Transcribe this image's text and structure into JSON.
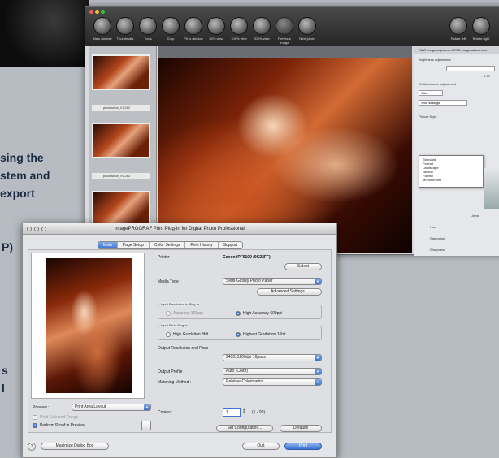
{
  "background_text": [
    "sing the",
    "stem and",
    " export",
    "P)",
    "s",
    "l"
  ],
  "dpp": {
    "window_dots": [
      "#ff5f57",
      "#ffbd2e",
      "#28c940"
    ],
    "toolbar": [
      {
        "label": "Main window",
        "icon": "window-icon"
      },
      {
        "label": "Thumbnails",
        "icon": "thumbnails-icon"
      },
      {
        "label": "Tools",
        "icon": "tools-icon"
      },
      {
        "label": "Crop",
        "icon": "crop-icon"
      },
      {
        "label": "Fit to window",
        "icon": "fit-icon"
      },
      {
        "label": "50% view",
        "icon": "zoom50-icon"
      },
      {
        "label": "100% view",
        "icon": "zoom100-icon"
      },
      {
        "label": "200% view",
        "icon": "zoom200-icon"
      },
      {
        "label": "Previous image",
        "icon": "prev-icon"
      },
      {
        "label": "Next photo",
        "icon": "next-icon"
      },
      {
        "label": "Rotate left",
        "icon": "rotate-left-icon"
      },
      {
        "label": "Rotate right",
        "icon": "rotate-right-icon"
      }
    ],
    "thumbnails": [
      "photoshub_XC282",
      "photoshub_XC283",
      "photoshub_XC284"
    ],
    "right_panel": {
      "tabs": "RAW image adjustment    RGB image adjustment",
      "brightness": "Brightness adjustment",
      "brightness_val": "0.00",
      "white_balance": "White balance adjustment",
      "wb_select": "Click",
      "shot_settings": "Shot settings",
      "picture_style": "Picture Style",
      "menu_items": [
        "Standard",
        "Portrait",
        "Landscape",
        "Neutral",
        "Faithful",
        "Monochrome"
      ],
      "linear": "Linear",
      "hue": "Hue",
      "saturation": "Saturation",
      "sharpness": "Sharpness",
      "status": "Standard",
      "status_right": "RGB"
    }
  },
  "dialog": {
    "title": "imagePROGRAF Print Plug-In for Digital Photo Professional",
    "tabs": [
      {
        "label": "Main",
        "active": true
      },
      {
        "label": "Page Setup",
        "active": false
      },
      {
        "label": "Color Settings",
        "active": false
      },
      {
        "label": "Print History",
        "active": false
      },
      {
        "label": "Support",
        "active": false
      }
    ],
    "printer_label": "Printer :",
    "printer_value": "Canon iPF6100 (9C22FF)",
    "select_button": "Select",
    "media_label": "Media Type :",
    "media_value": "Semi-Glossy Photo Paper",
    "advanced_button": "Advanced Settings...",
    "res_group": "Input Resolution to Plug-in",
    "res_opt1": "Accuracy 300ppi",
    "res_opt2": "High Accuracy 600ppi",
    "bit_group": "Input Bit to Plug-in",
    "bit_opt1": "High Gradation 8bit",
    "bit_opt2": "Highest Gradation 16bit",
    "output_res_label": "Output Resolution and Pass :",
    "output_res_value": "2400x1200dpi 16pass",
    "profile_label": "Output Profile :",
    "profile_value": "Auto (Color)",
    "matching_label": "Matching Method :",
    "matching_value": "Relative Colorimetric",
    "preview_label": "Preview :",
    "preview_value": "Print Area Layout",
    "print_selected_range": "Print Selected Range",
    "perform_proof": "Perform Proof in Preview",
    "copies_label": "Copies :",
    "copies_value": "1",
    "copies_range": "(1 - 99)",
    "set_config_button": "Set Configuration...",
    "defaults_button": "Defaults",
    "maximize_button": "Maximize Dialog Box",
    "quit_button": "Quit",
    "print_button": "Print"
  }
}
